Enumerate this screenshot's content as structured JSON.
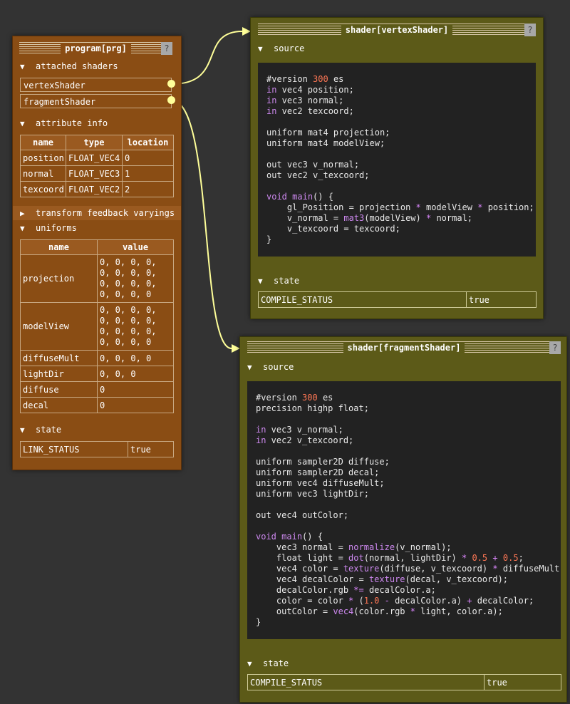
{
  "program": {
    "title": "program[prg]",
    "help": "?",
    "attached_shaders_label": "attached shaders",
    "attached_shaders": [
      "vertexShader",
      "fragmentShader"
    ],
    "attribute_info_label": "attribute info",
    "attribute_headers": [
      "name",
      "type",
      "location"
    ],
    "attributes": [
      [
        "position",
        "FLOAT_VEC4",
        "0"
      ],
      [
        "normal",
        "FLOAT_VEC3",
        "1"
      ],
      [
        "texcoord",
        "FLOAT_VEC2",
        "2"
      ]
    ],
    "tf_label": "transform feedback varyings",
    "uniforms_label": "uniforms",
    "uniform_headers": [
      "name",
      "value"
    ],
    "uniforms": [
      [
        "projection",
        "0, 0, 0, 0,\n0, 0, 0, 0,\n0, 0, 0, 0,\n0, 0, 0, 0"
      ],
      [
        "modelView",
        "0, 0, 0, 0,\n0, 0, 0, 0,\n0, 0, 0, 0,\n0, 0, 0, 0"
      ],
      [
        "diffuseMult",
        "0, 0, 0, 0"
      ],
      [
        "lightDir",
        "0, 0, 0"
      ],
      [
        "diffuse",
        "0"
      ],
      [
        "decal",
        "0"
      ]
    ],
    "state_label": "state",
    "state": [
      "LINK_STATUS",
      "true"
    ]
  },
  "vertex_shader": {
    "title": "shader[vertexShader]",
    "help": "?",
    "source_label": "source",
    "source": [
      [
        [
          "t",
          "#version "
        ],
        [
          "n",
          "300"
        ],
        [
          "t",
          " es"
        ]
      ],
      [
        [
          "k",
          "in"
        ],
        [
          "t",
          " vec4 position;"
        ]
      ],
      [
        [
          "k",
          "in"
        ],
        [
          "t",
          " vec3 normal;"
        ]
      ],
      [
        [
          "k",
          "in"
        ],
        [
          "t",
          " vec2 texcoord;"
        ]
      ],
      [],
      [
        [
          "t",
          "uniform mat4 projection;"
        ]
      ],
      [
        [
          "t",
          "uniform mat4 modelView;"
        ]
      ],
      [],
      [
        [
          "t",
          "out vec3 v_normal;"
        ]
      ],
      [
        [
          "t",
          "out vec2 v_texcoord;"
        ]
      ],
      [],
      [
        [
          "k",
          "void"
        ],
        [
          "t",
          " "
        ],
        [
          "k",
          "main"
        ],
        [
          "t",
          "() {"
        ]
      ],
      [
        [
          "t",
          "    gl_Position = projection "
        ],
        [
          "o",
          "*"
        ],
        [
          "t",
          " modelView "
        ],
        [
          "o",
          "*"
        ],
        [
          "t",
          " position;"
        ]
      ],
      [
        [
          "t",
          "    v_normal = "
        ],
        [
          "k",
          "mat3"
        ],
        [
          "t",
          "(modelView) "
        ],
        [
          "o",
          "*"
        ],
        [
          "t",
          " normal;"
        ]
      ],
      [
        [
          "t",
          "    v_texcoord = texcoord;"
        ]
      ],
      [
        [
          "t",
          "}"
        ]
      ]
    ],
    "state_label": "state",
    "state": [
      "COMPILE_STATUS",
      "true"
    ]
  },
  "fragment_shader": {
    "title": "shader[fragmentShader]",
    "help": "?",
    "source_label": "source",
    "source": [
      [
        [
          "t",
          "#version "
        ],
        [
          "n",
          "300"
        ],
        [
          "t",
          " es"
        ]
      ],
      [
        [
          "t",
          "precision highp float;"
        ]
      ],
      [],
      [
        [
          "k",
          "in"
        ],
        [
          "t",
          " vec3 v_normal;"
        ]
      ],
      [
        [
          "k",
          "in"
        ],
        [
          "t",
          " vec2 v_texcoord;"
        ]
      ],
      [],
      [
        [
          "t",
          "uniform sampler2D diffuse;"
        ]
      ],
      [
        [
          "t",
          "uniform sampler2D decal;"
        ]
      ],
      [
        [
          "t",
          "uniform vec4 diffuseMult;"
        ]
      ],
      [
        [
          "t",
          "uniform vec3 lightDir;"
        ]
      ],
      [],
      [
        [
          "t",
          "out vec4 outColor;"
        ]
      ],
      [],
      [
        [
          "k",
          "void"
        ],
        [
          "t",
          " "
        ],
        [
          "k",
          "main"
        ],
        [
          "t",
          "() {"
        ]
      ],
      [
        [
          "t",
          "    vec3 normal = "
        ],
        [
          "k",
          "normalize"
        ],
        [
          "t",
          "(v_normal);"
        ]
      ],
      [
        [
          "t",
          "    float light = "
        ],
        [
          "k",
          "dot"
        ],
        [
          "t",
          "(normal, lightDir) "
        ],
        [
          "o",
          "*"
        ],
        [
          "t",
          " "
        ],
        [
          "n",
          "0.5"
        ],
        [
          "t",
          " "
        ],
        [
          "o",
          "+"
        ],
        [
          "t",
          " "
        ],
        [
          "n",
          "0.5"
        ],
        [
          "t",
          ";"
        ]
      ],
      [
        [
          "t",
          "    vec4 color = "
        ],
        [
          "k",
          "texture"
        ],
        [
          "t",
          "(diffuse, v_texcoord) "
        ],
        [
          "o",
          "*"
        ],
        [
          "t",
          " diffuseMult;"
        ]
      ],
      [
        [
          "t",
          "    vec4 decalColor = "
        ],
        [
          "k",
          "texture"
        ],
        [
          "t",
          "(decal, v_texcoord);"
        ]
      ],
      [
        [
          "t",
          "    decalColor.rgb "
        ],
        [
          "o",
          "*="
        ],
        [
          "t",
          " decalColor.a;"
        ]
      ],
      [
        [
          "t",
          "    color = color "
        ],
        [
          "o",
          "*"
        ],
        [
          "t",
          " ("
        ],
        [
          "n",
          "1.0"
        ],
        [
          "t",
          " "
        ],
        [
          "o",
          "-"
        ],
        [
          "t",
          " decalColor.a) "
        ],
        [
          "o",
          "+"
        ],
        [
          "t",
          " decalColor;"
        ]
      ],
      [
        [
          "t",
          "    outColor = "
        ],
        [
          "k",
          "vec4"
        ],
        [
          "t",
          "(color.rgb "
        ],
        [
          "o",
          "*"
        ],
        [
          "t",
          " light, color.a);"
        ]
      ],
      [
        [
          "t",
          "}"
        ]
      ]
    ],
    "state_label": "state",
    "state": [
      "COMPILE_STATUS",
      "true"
    ]
  },
  "colors": {
    "background": "#333333",
    "program_panel": "#8a4d14",
    "shader_panel": "#5c5a18",
    "code_background": "#222222",
    "connector": "#ffff99",
    "keyword": "#cc88ee",
    "number": "#ff7755"
  },
  "icons": {
    "expanded": "▼",
    "collapsed": "▶"
  }
}
